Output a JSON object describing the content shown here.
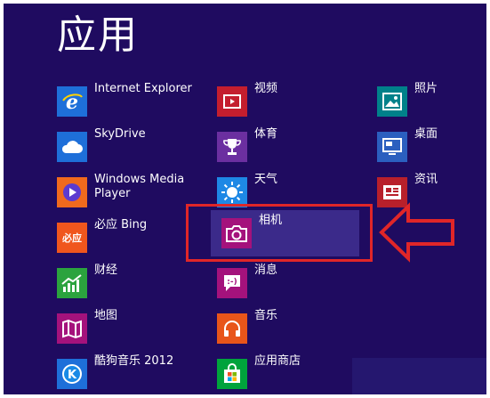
{
  "screen": {
    "title": "应用",
    "colors": {
      "background": "#1f0b60",
      "selected_tile": "#3b2a8a",
      "highlight": "#e02628"
    }
  },
  "apps": {
    "col1": [
      {
        "label": "Internet Explorer",
        "icon": "internet-explorer-icon",
        "color": "#1e6fd9"
      },
      {
        "label": "SkyDrive",
        "icon": "skydrive-cloud-icon",
        "color": "#1e6fd9"
      },
      {
        "label": "Windows Media Player",
        "icon": "media-player-icon",
        "color": "#f06a1d"
      },
      {
        "label": "必应 Bing",
        "tile_text": "必应",
        "icon": "bing-icon",
        "color": "#f0561d"
      },
      {
        "label": "财经",
        "icon": "finance-chart-icon",
        "color": "#2ba33e"
      },
      {
        "label": "地图",
        "icon": "map-icon",
        "color": "#a4127c"
      },
      {
        "label": "酷狗音乐 2012",
        "icon": "kugou-music-icon",
        "color": "#1e6fd9"
      }
    ],
    "col2": [
      {
        "label": "视频",
        "icon": "video-icon",
        "color": "#c41e2e"
      },
      {
        "label": "体育",
        "icon": "trophy-icon",
        "color": "#6b2fa0"
      },
      {
        "label": "天气",
        "icon": "weather-sun-icon",
        "color": "#1e88e5"
      },
      {
        "label": "相机",
        "icon": "camera-icon",
        "color": "#a4127c"
      },
      {
        "label": "消息",
        "icon": "messaging-icon",
        "color": "#a4127c"
      },
      {
        "label": "音乐",
        "icon": "headphones-icon",
        "color": "#e8551a"
      },
      {
        "label": "应用商店",
        "icon": "store-icon",
        "color": "#00a33c"
      }
    ],
    "col3": [
      {
        "label": "照片",
        "icon": "photos-icon",
        "color": "#00818a"
      },
      {
        "label": "桌面",
        "icon": "desktop-icon",
        "color": "#2b5fbf"
      },
      {
        "label": "资讯",
        "icon": "news-icon",
        "color": "#b8202b"
      }
    ]
  }
}
